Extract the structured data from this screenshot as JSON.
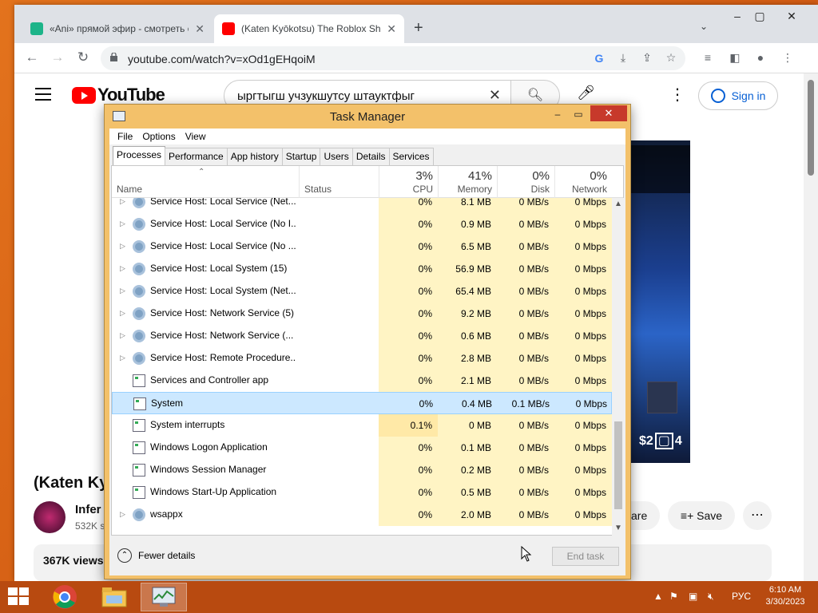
{
  "browser": {
    "tabs": [
      {
        "title": "«Ani» прямой эфир - смотреть о",
        "color": "#1db489"
      },
      {
        "title": "(Katen Kyōkotsu) The Roblox Shu",
        "color": "#ff0000"
      }
    ],
    "new_tab": "+",
    "url": "youtube.com/watch?v=xOd1gEHqoiM"
  },
  "youtube": {
    "logo_text": "YouTube",
    "search_value": "ыргтыгш учзукшутсу штауктфыг",
    "sign_in": "Sign in",
    "video_title": "(Katen Kyō",
    "channel_name": "Infer",
    "subscribers": "532K s",
    "share_label": "are",
    "save_label": "Save",
    "views": "367K views",
    "overlay_money": "$2",
    "overlay_money_end": "4"
  },
  "taskmanager": {
    "title": "Task Manager",
    "menu": [
      "File",
      "Options",
      "View"
    ],
    "tabs": [
      "Processes",
      "Performance",
      "App history",
      "Startup",
      "Users",
      "Details",
      "Services"
    ],
    "columns": {
      "name": "Name",
      "status": "Status",
      "cpu": {
        "pct": "3%",
        "label": "CPU"
      },
      "memory": {
        "pct": "41%",
        "label": "Memory"
      },
      "disk": {
        "pct": "0%",
        "label": "Disk"
      },
      "network": {
        "pct": "0%",
        "label": "Network"
      }
    },
    "rows": [
      {
        "name": "Service Host: Local Service (Net...",
        "cpu": "0%",
        "mem": "8.1 MB",
        "disk": "0 MB/s",
        "net": "0 Mbps",
        "icon": "gear",
        "expand": true
      },
      {
        "name": "Service Host: Local Service (No I...",
        "cpu": "0%",
        "mem": "0.9 MB",
        "disk": "0 MB/s",
        "net": "0 Mbps",
        "icon": "gear",
        "expand": true
      },
      {
        "name": "Service Host: Local Service (No ...",
        "cpu": "0%",
        "mem": "6.5 MB",
        "disk": "0 MB/s",
        "net": "0 Mbps",
        "icon": "gear",
        "expand": true
      },
      {
        "name": "Service Host: Local System (15)",
        "cpu": "0%",
        "mem": "56.9 MB",
        "disk": "0 MB/s",
        "net": "0 Mbps",
        "icon": "gear",
        "expand": true
      },
      {
        "name": "Service Host: Local System (Net...",
        "cpu": "0%",
        "mem": "65.4 MB",
        "disk": "0 MB/s",
        "net": "0 Mbps",
        "icon": "gear",
        "expand": true
      },
      {
        "name": "Service Host: Network Service (5)",
        "cpu": "0%",
        "mem": "9.2 MB",
        "disk": "0 MB/s",
        "net": "0 Mbps",
        "icon": "gear",
        "expand": true
      },
      {
        "name": "Service Host: Network Service (...",
        "cpu": "0%",
        "mem": "0.6 MB",
        "disk": "0 MB/s",
        "net": "0 Mbps",
        "icon": "gear",
        "expand": true
      },
      {
        "name": "Service Host: Remote Procedure...",
        "cpu": "0%",
        "mem": "2.8 MB",
        "disk": "0 MB/s",
        "net": "0 Mbps",
        "icon": "gear",
        "expand": true
      },
      {
        "name": "Services and Controller app",
        "cpu": "0%",
        "mem": "2.1 MB",
        "disk": "0 MB/s",
        "net": "0 Mbps",
        "icon": "app",
        "expand": false
      },
      {
        "name": "System",
        "cpu": "0%",
        "mem": "0.4 MB",
        "disk": "0.1 MB/s",
        "net": "0 Mbps",
        "icon": "app",
        "expand": false,
        "selected": true
      },
      {
        "name": "System interrupts",
        "cpu": "0.1%",
        "mem": "0 MB",
        "disk": "0 MB/s",
        "net": "0 Mbps",
        "icon": "app",
        "expand": false
      },
      {
        "name": "Windows Logon Application",
        "cpu": "0%",
        "mem": "0.1 MB",
        "disk": "0 MB/s",
        "net": "0 Mbps",
        "icon": "app",
        "expand": false
      },
      {
        "name": "Windows Session Manager",
        "cpu": "0%",
        "mem": "0.2 MB",
        "disk": "0 MB/s",
        "net": "0 Mbps",
        "icon": "app",
        "expand": false
      },
      {
        "name": "Windows Start-Up Application",
        "cpu": "0%",
        "mem": "0.5 MB",
        "disk": "0 MB/s",
        "net": "0 Mbps",
        "icon": "app",
        "expand": false
      },
      {
        "name": "wsappx",
        "cpu": "0%",
        "mem": "2.0 MB",
        "disk": "0 MB/s",
        "net": "0 Mbps",
        "icon": "gear",
        "expand": true
      }
    ],
    "fewer_details": "Fewer details",
    "end_task": "End task"
  },
  "taskbar": {
    "language": "РУС",
    "time": "6:10 AM",
    "date": "3/30/2023"
  }
}
